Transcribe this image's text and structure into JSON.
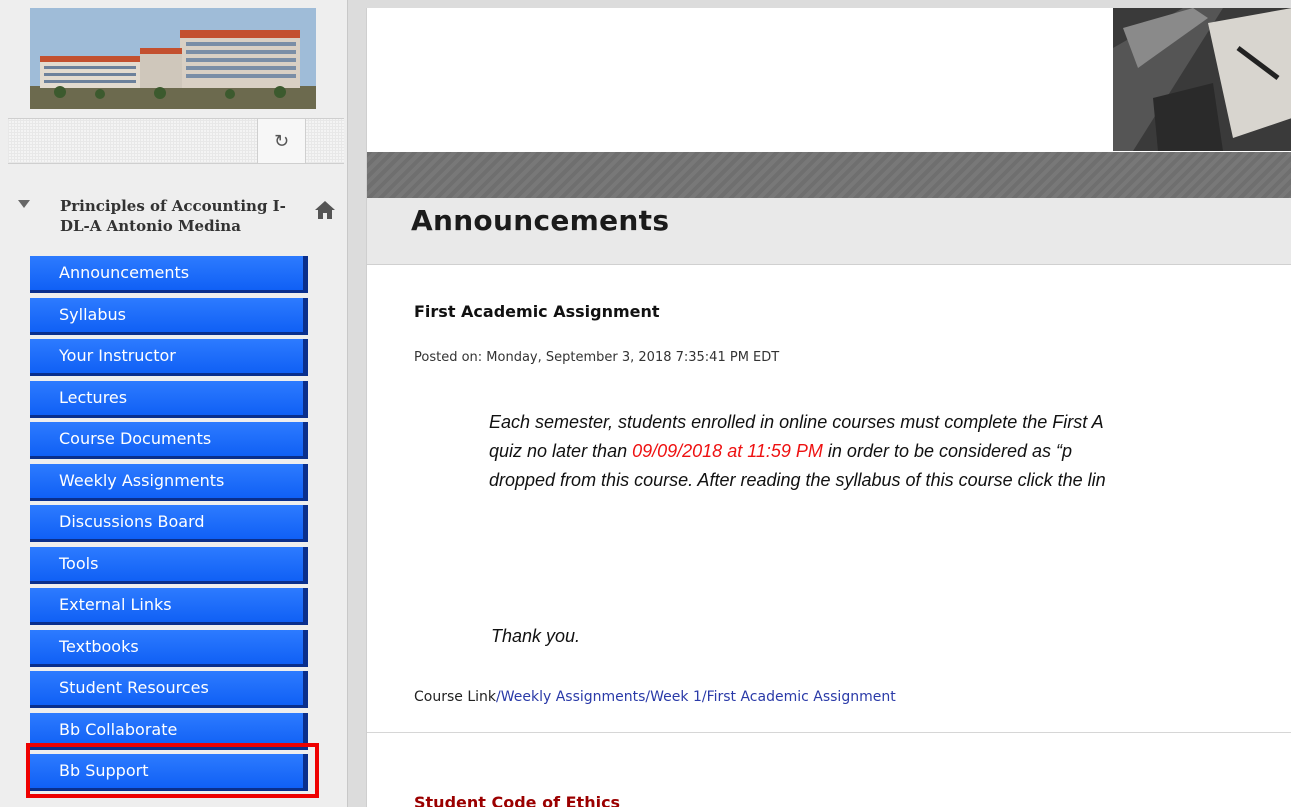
{
  "sidebar": {
    "course_title": "Principles of Accounting I-DL-A Antonio Medina",
    "items": [
      {
        "label": "Announcements"
      },
      {
        "label": "Syllabus"
      },
      {
        "label": "Your Instructor"
      },
      {
        "label": "Lectures"
      },
      {
        "label": "Course Documents"
      },
      {
        "label": "Weekly Assignments"
      },
      {
        "label": "Discussions Board"
      },
      {
        "label": "Tools"
      },
      {
        "label": "External Links"
      },
      {
        "label": "Textbooks"
      },
      {
        "label": "Student Resources"
      },
      {
        "label": "Bb Collaborate"
      },
      {
        "label": "Bb Support"
      }
    ],
    "highlighted_item": "Bb Support",
    "nav_color": "#1a6bff",
    "highlight_color": "#ee0000"
  },
  "toolbar": {
    "refresh_icon": "refresh-icon"
  },
  "main": {
    "page_title": "Announcements",
    "announcement": {
      "title": "First Academic Assignment",
      "posted": "Posted on: Monday, September 3, 2018 7:35:41 PM EDT",
      "line1": "Each semester, students enrolled in online courses must complete the First A",
      "line2_a": "quiz no later than ",
      "line2_red": "09/09/2018 at 11:59 PM",
      "line2_b": " in order to be considered as “p",
      "line3": "dropped from this course. After reading the syllabus of this course click the lin",
      "thanks": "Thank you.",
      "course_link_prefix": "Course Link",
      "course_link_path": "/Weekly Assignments/Week 1/First Academic Assignment"
    },
    "next_announcement_title": "Student Code of Ethics"
  }
}
